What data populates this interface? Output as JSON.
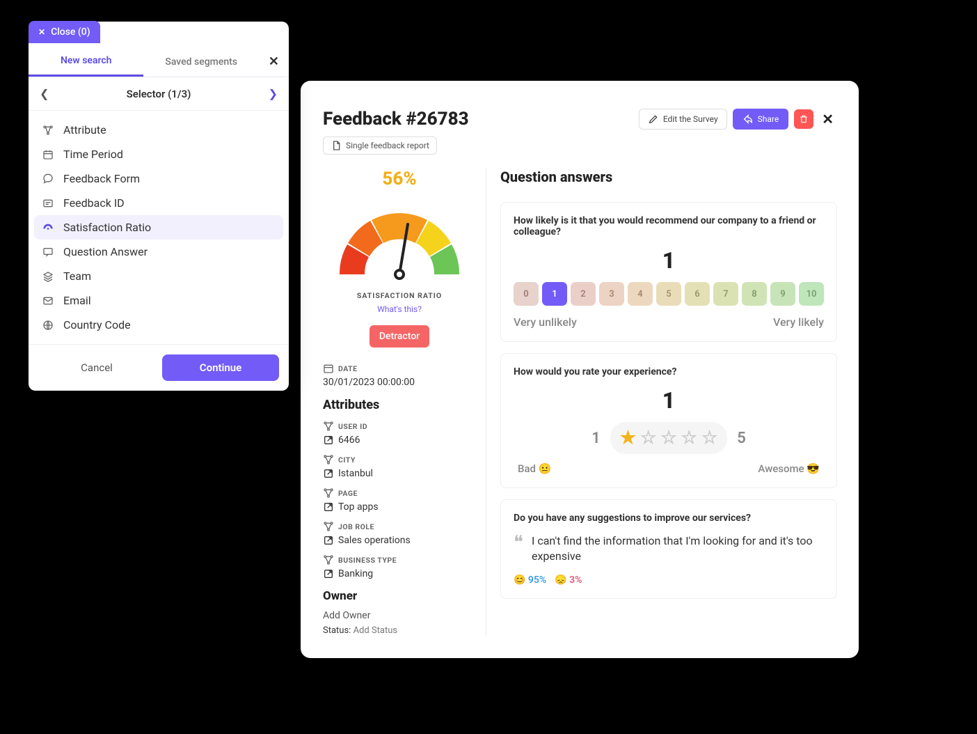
{
  "search": {
    "close_label": "Close (0)",
    "tabs": {
      "new": "New search",
      "saved": "Saved segments"
    },
    "selector_label": "Selector (1/3)",
    "items": [
      {
        "label": "Attribute",
        "icon": "attr"
      },
      {
        "label": "Time Period",
        "icon": "calendar"
      },
      {
        "label": "Feedback Form",
        "icon": "form"
      },
      {
        "label": "Feedback ID",
        "icon": "id"
      },
      {
        "label": "Satisfaction Ratio",
        "icon": "gauge",
        "selected": true
      },
      {
        "label": "Question Answer",
        "icon": "qa"
      },
      {
        "label": "Team",
        "icon": "team"
      },
      {
        "label": "Email",
        "icon": "mail"
      },
      {
        "label": "Country Code",
        "icon": "country"
      }
    ],
    "cancel": "Cancel",
    "continue": "Continue"
  },
  "detail": {
    "title": "Feedback #26783",
    "report_chip": "Single feedback report",
    "actions": {
      "edit": "Edit the Survey",
      "share": "Share"
    },
    "gauge": {
      "pct": "56%",
      "label": "SATISFACTION RATIO",
      "link": "What's this?",
      "badge": "Detractor"
    },
    "date_label": "DATE",
    "date_value": "30/01/2023 00:00:00",
    "attributes_h": "Attributes",
    "attributes": [
      {
        "label": "USER ID",
        "value": "6466"
      },
      {
        "label": "CITY",
        "value": "Istanbul"
      },
      {
        "label": "PAGE",
        "value": "Top apps"
      },
      {
        "label": "JOB ROLE",
        "value": "Sales operations"
      },
      {
        "label": "BUSINESS TYPE",
        "value": "Banking"
      }
    ],
    "owner_h": "Owner",
    "add_owner": "Add Owner",
    "status_label": "Status:",
    "status_value": "Add Status",
    "qa_h": "Question answers",
    "q1": {
      "text": "How likely is it that you would recommend our company to a friend or colleague?",
      "value": "1",
      "low": "Very unlikely",
      "high": "Very likely",
      "scale": [
        "0",
        "1",
        "2",
        "3",
        "4",
        "5",
        "6",
        "7",
        "8",
        "9",
        "10"
      ]
    },
    "q2": {
      "text": "How would you rate your experience?",
      "value": "1",
      "low_n": "1",
      "high_n": "5",
      "low": "Bad 😐",
      "high": "Awesome 😎"
    },
    "q3": {
      "text": "Do you have any suggestions to improve our services?",
      "answer": "I can't find the information that I'm looking for and it's too expensive",
      "pos": "95%",
      "neg": "3%"
    }
  },
  "chart_data": {
    "type": "gauge",
    "value": 56,
    "min": 0,
    "max": 100,
    "title": "Satisfaction Ratio",
    "segments": [
      {
        "color": "#e93c1f",
        "range": [
          0,
          20
        ]
      },
      {
        "color": "#f26a1c",
        "range": [
          20,
          40
        ]
      },
      {
        "color": "#f59a1d",
        "range": [
          40,
          60
        ]
      },
      {
        "color": "#f5d31d",
        "range": [
          60,
          80
        ]
      },
      {
        "color": "#6bc557",
        "range": [
          80,
          100
        ]
      }
    ]
  }
}
